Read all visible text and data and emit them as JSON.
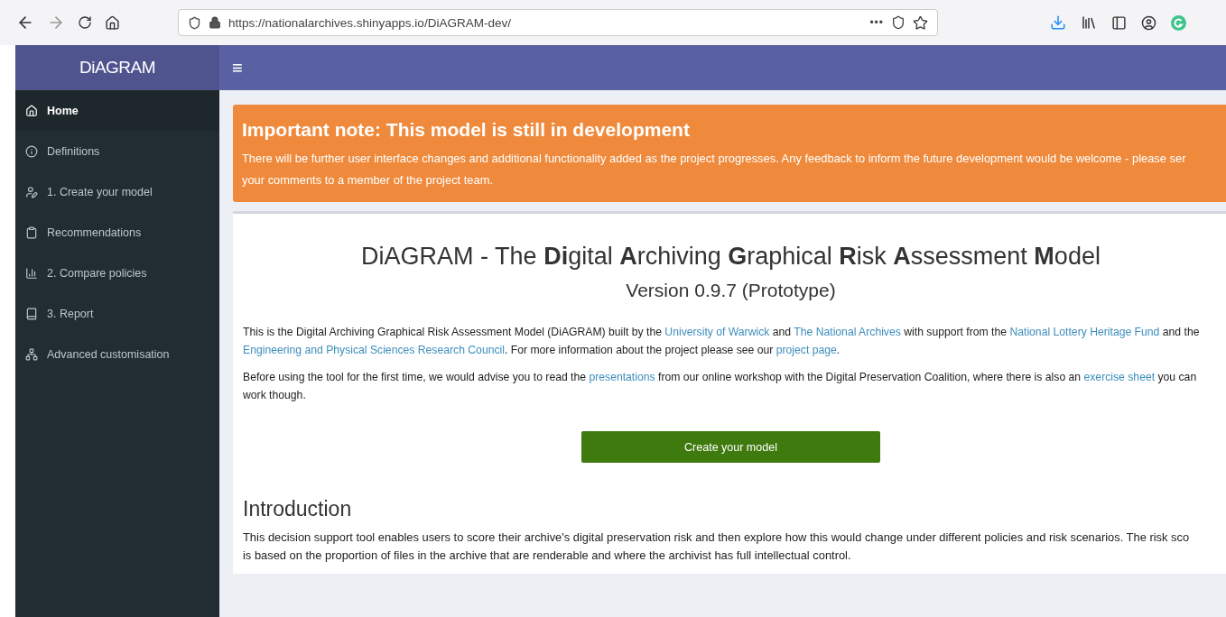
{
  "browser": {
    "url": "https://nationalarchives.shinyapps.io/DiAGRAM-dev/",
    "menu": "•••"
  },
  "app": {
    "logo": "DiAGRAM",
    "toggle": "≡"
  },
  "sidebar": {
    "items": [
      {
        "label": "Home",
        "selected": true
      },
      {
        "label": "Definitions",
        "selected": false
      },
      {
        "label": "1. Create your model",
        "selected": false
      },
      {
        "label": "Recommendations",
        "selected": false
      },
      {
        "label": "2. Compare policies",
        "selected": false
      },
      {
        "label": "3. Report",
        "selected": false
      },
      {
        "label": "Advanced customisation",
        "selected": false
      }
    ]
  },
  "alert": {
    "title": "Important note: This model is still in development",
    "lines": [
      "There will be further user interface changes and additional functionality added as the project progresses. Any feedback to inform the future development would be welcome - please ser",
      "your comments to a member of the project team."
    ]
  },
  "main": {
    "title": "DiAGRAM - The **Di**gital **A**rchiving **G**raphical **R**isk **A**ssessment **M**odel",
    "version": "Version 0.9.7 (Prototype)",
    "paragraphs": [
      [
        {
          "text": "This is the Digital Archiving Graphical Risk Assessment Model (DiAGRAM) built by the ",
          "kind": "text"
        },
        {
          "text": "University of Warwick",
          "kind": "link"
        },
        {
          "text": " and ",
          "kind": "text"
        },
        {
          "text": "The National Archives",
          "kind": "link"
        },
        {
          "text": " with support from the ",
          "kind": "text"
        },
        {
          "text": "National Lottery Heritage Fund",
          "kind": "link"
        },
        {
          "text": " and the ",
          "kind": "text"
        },
        {
          "text": "Engineering and Physical Sciences Research Council",
          "kind": "link"
        },
        {
          "text": ". For more information about the project please see our ",
          "kind": "text"
        },
        {
          "text": "project page",
          "kind": "link"
        },
        {
          "text": ".",
          "kind": "text"
        }
      ],
      [
        {
          "text": "Before using the tool for the first time, we would advise you to read the ",
          "kind": "text"
        },
        {
          "text": "presentations",
          "kind": "link"
        },
        {
          "text": " from our online workshop with the Digital Preservation Coalition, where there is also an ",
          "kind": "text"
        },
        {
          "text": "exercise sheet",
          "kind": "link"
        },
        {
          "text": " you can work though.",
          "kind": "text"
        }
      ]
    ],
    "button": "Create your model",
    "section": "Introduction",
    "intro_lines": [
      "This decision support tool enables users to score their archive's digital preservation risk and then explore how this would change under different policies and risk scenarios. The risk sco",
      "is based on the proportion of files in the archive that are renderable and where the archivist has full intellectual control."
    ]
  }
}
